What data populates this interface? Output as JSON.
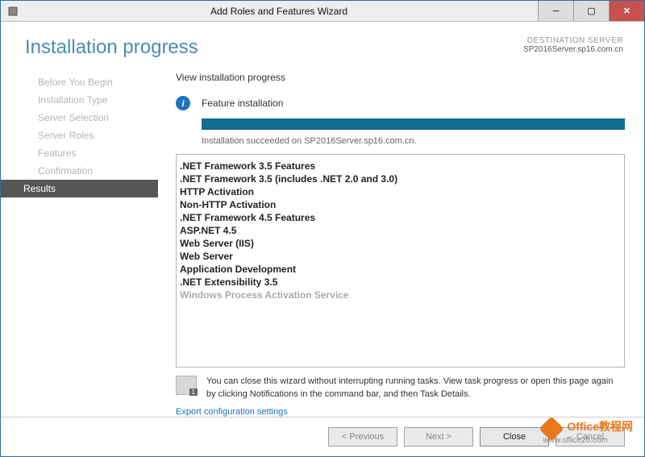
{
  "window": {
    "title": "Add Roles and Features Wizard"
  },
  "header": {
    "title": "Installation progress",
    "destination_label": "DESTINATION SERVER",
    "destination_server": "SP2016Server.sp16.com.cn"
  },
  "sidebar": {
    "items": [
      {
        "label": "Before You Begin"
      },
      {
        "label": "Installation Type"
      },
      {
        "label": "Server Selection"
      },
      {
        "label": "Server Roles"
      },
      {
        "label": "Features"
      },
      {
        "label": "Confirmation"
      },
      {
        "label": "Results"
      }
    ]
  },
  "main": {
    "heading": "View installation progress",
    "status_label": "Feature installation",
    "status_message": "Installation succeeded on SP2016Server.sp16.com.cn.",
    "features": [
      {
        "label": ".NET Framework 3.5 Features",
        "indent": 1
      },
      {
        "label": ".NET Framework 3.5 (includes .NET 2.0 and 3.0)",
        "indent": 2
      },
      {
        "label": "HTTP Activation",
        "indent": 2
      },
      {
        "label": "Non-HTTP Activation",
        "indent": 2
      },
      {
        "label": ".NET Framework 4.5 Features",
        "indent": 1
      },
      {
        "label": "ASP.NET 4.5",
        "indent": 2
      },
      {
        "label": "Web Server (IIS)",
        "indent": 1
      },
      {
        "label": "Web Server",
        "indent": 2
      },
      {
        "label": "Application Development",
        "indent": 3
      },
      {
        "label": ".NET Extensibility 3.5",
        "indent": 4
      },
      {
        "label": "Windows Process Activation Service",
        "indent": 1
      }
    ],
    "note": "You can close this wizard without interrupting running tasks. View task progress or open this page again by clicking Notifications in the command bar, and then Task Details.",
    "export_link": "Export configuration settings"
  },
  "footer": {
    "previous": "<  Previous",
    "next": "Next  >",
    "close": "Close",
    "cancel": "Cancel"
  },
  "watermark": {
    "title": "Office教程网",
    "url": "www.office26.com"
  }
}
